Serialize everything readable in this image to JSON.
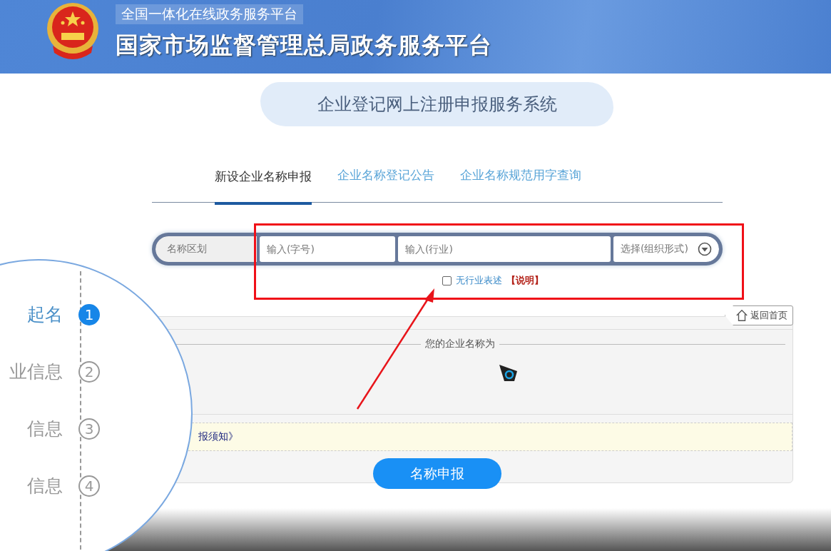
{
  "header": {
    "subtitle": "全国一体化在线政务服务平台",
    "title": "国家市场监督管理总局政务服务平台"
  },
  "system_title": "企业登记网上注册申报服务系统",
  "tabs": [
    {
      "label": "新设企业名称申报",
      "selected": true
    },
    {
      "label": "企业名称登记公告",
      "selected": false
    },
    {
      "label": "企业名称规范用字查询",
      "selected": false
    }
  ],
  "name_form": {
    "region_label": "名称区划",
    "fields": [
      {
        "kind": "input",
        "placeholder": "输入(字号)"
      },
      {
        "kind": "input",
        "placeholder": "输入(行业)"
      },
      {
        "kind": "select",
        "placeholder": "选择(组织形式)"
      }
    ],
    "no_industry": {
      "label": "无行业表述",
      "checked": false
    },
    "note_link": "【说明】"
  },
  "back_button": "返回首页",
  "result": {
    "legend": "您的企业名称为"
  },
  "notice_link": "报须知》",
  "submit_button": "名称申报",
  "steps": [
    {
      "label": "起名",
      "number": "1",
      "selected": true
    },
    {
      "label": "业信息",
      "number": "2",
      "selected": false
    },
    {
      "label": "信息",
      "number": "3",
      "selected": false
    },
    {
      "label": "信息",
      "number": "4",
      "selected": false
    }
  ]
}
